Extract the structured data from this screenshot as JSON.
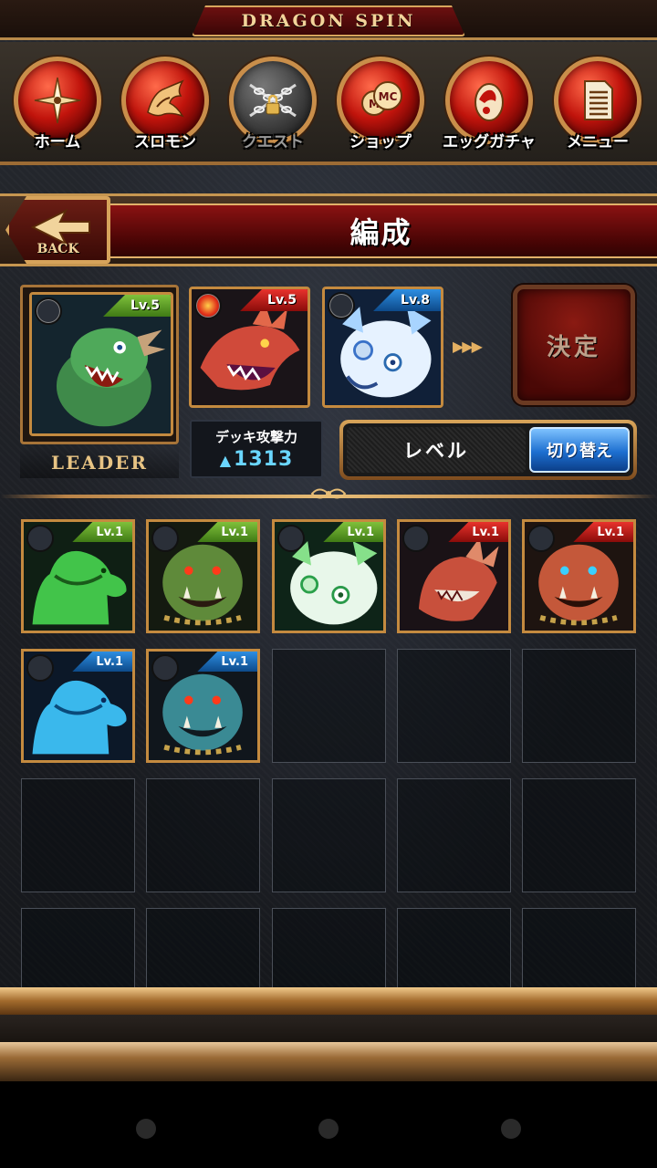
{
  "title": "DRAGON SPIN",
  "nav": {
    "items": [
      {
        "label": "ホーム",
        "icon": "compass-icon",
        "locked": false
      },
      {
        "label": "スロモン",
        "icon": "dragon-emblem-icon",
        "locked": false
      },
      {
        "label": "クエスト",
        "icon": "chained-lock-icon",
        "locked": true
      },
      {
        "label": "ショップ",
        "icon": "coin-icon",
        "locked": false
      },
      {
        "label": "エッグガチャ",
        "icon": "egg-icon",
        "locked": false
      },
      {
        "label": "メニュー",
        "icon": "document-icon",
        "locked": false
      }
    ]
  },
  "header": {
    "title": "編成",
    "back_label": "BACK"
  },
  "deck": {
    "leader_label": "LEADER",
    "leader": {
      "level": "Lv.5",
      "level_color": "green",
      "element": "green-dragon"
    },
    "members": [
      {
        "level": "Lv.5",
        "level_color": "red",
        "element": "red-dragon"
      },
      {
        "level": "Lv.8",
        "level_color": "blue",
        "element": "white-dragon"
      }
    ],
    "arrows": "▶▶▶",
    "decide_label": "決定",
    "power_label": "デッキ攻撃力",
    "power_arrow": "▲",
    "power_value": "1313"
  },
  "sort": {
    "label": "レベル",
    "toggle_label": "切り替え"
  },
  "inventory": {
    "monsters": [
      {
        "level": "Lv.1",
        "level_color": "green",
        "type": "green-slime"
      },
      {
        "level": "Lv.1",
        "level_color": "green",
        "type": "green-orc"
      },
      {
        "level": "Lv.1",
        "level_color": "green",
        "type": "white-green-dragon"
      },
      {
        "level": "Lv.1",
        "level_color": "red",
        "type": "red-dragon"
      },
      {
        "level": "Lv.1",
        "level_color": "red",
        "type": "red-orc"
      },
      {
        "level": "Lv.1",
        "level_color": "blue",
        "type": "blue-slime"
      },
      {
        "level": "Lv.1",
        "level_color": "blue",
        "type": "blue-orc"
      }
    ],
    "total_slots": 20
  }
}
